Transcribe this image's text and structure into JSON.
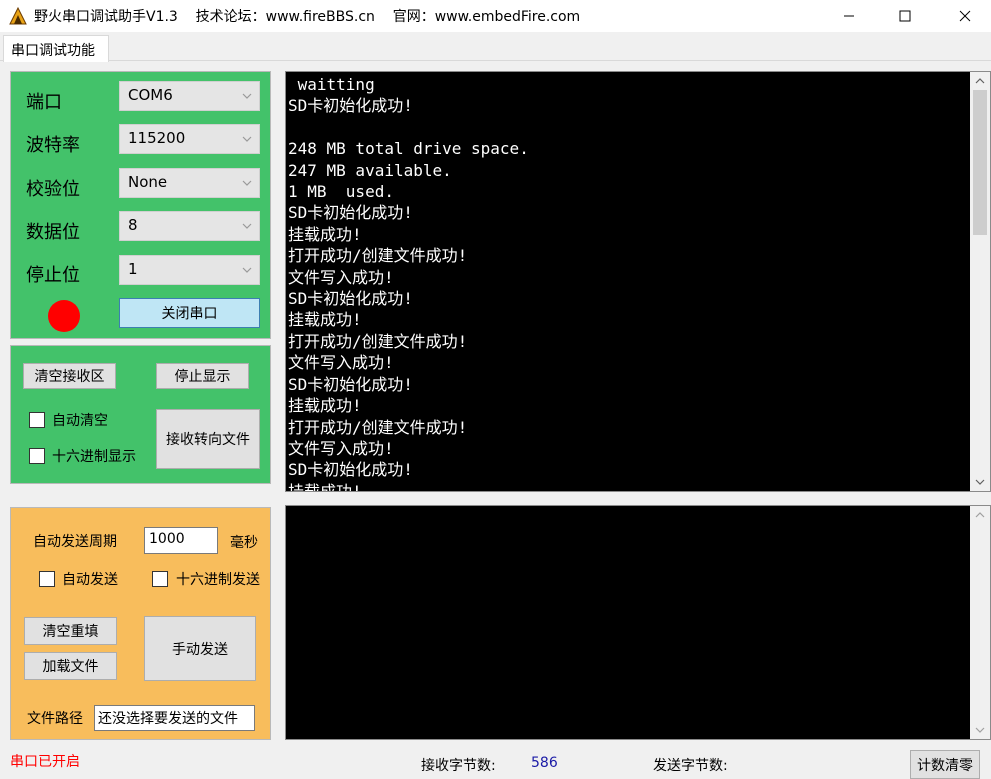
{
  "window": {
    "title": "野火串口调试助手V1.3    技术论坛：www.fireBBS.cn    官网：www.embedFire.com"
  },
  "tabs": [
    {
      "label": "串口调试功能"
    }
  ],
  "serial": {
    "port_label": "端口",
    "port_value": "COM6",
    "baud_label": "波特率",
    "baud_value": "115200",
    "parity_label": "校验位",
    "parity_value": "None",
    "databits_label": "数据位",
    "databits_value": "8",
    "stopbits_label": "停止位",
    "stopbits_value": "1",
    "close_button": "关闭串口",
    "indicator_color": "#ff0000"
  },
  "receive": {
    "clear_button": "清空接收区",
    "stop_button": "停止显示",
    "auto_clear_label": "自动清空",
    "hex_display_label": "十六进制显示",
    "to_file_button": "接收转向文件",
    "text": " waitting\nSD卡初始化成功!\n\n248 MB total drive space.\n247 MB available.\n1 MB  used.\nSD卡初始化成功!\n挂载成功!\n打开成功/创建文件成功!\n文件写入成功!\nSD卡初始化成功!\n挂载成功!\n打开成功/创建文件成功!\n文件写入成功!\nSD卡初始化成功!\n挂载成功!\n打开成功/创建文件成功!\n文件写入成功!\nSD卡初始化成功!\n挂载成功!"
  },
  "send": {
    "period_label": "自动发送周期",
    "period_value": "1000",
    "period_unit": "毫秒",
    "auto_send_label": "自动发送",
    "hex_send_label": "十六进制发送",
    "clear_refill_button": "清空重填",
    "load_file_button": "加载文件",
    "manual_send_button": "手动发送",
    "file_path_label": "文件路径",
    "file_path_value": "还没选择要发送的文件",
    "text": ""
  },
  "status": {
    "port_status": "串口已开启",
    "port_status_color": "#ff0000",
    "recv_bytes_label": "接收字节数:",
    "recv_bytes_value": "586",
    "send_bytes_label": "发送字节数:",
    "send_bytes_value": "",
    "reset_count_button": "计数清零"
  }
}
